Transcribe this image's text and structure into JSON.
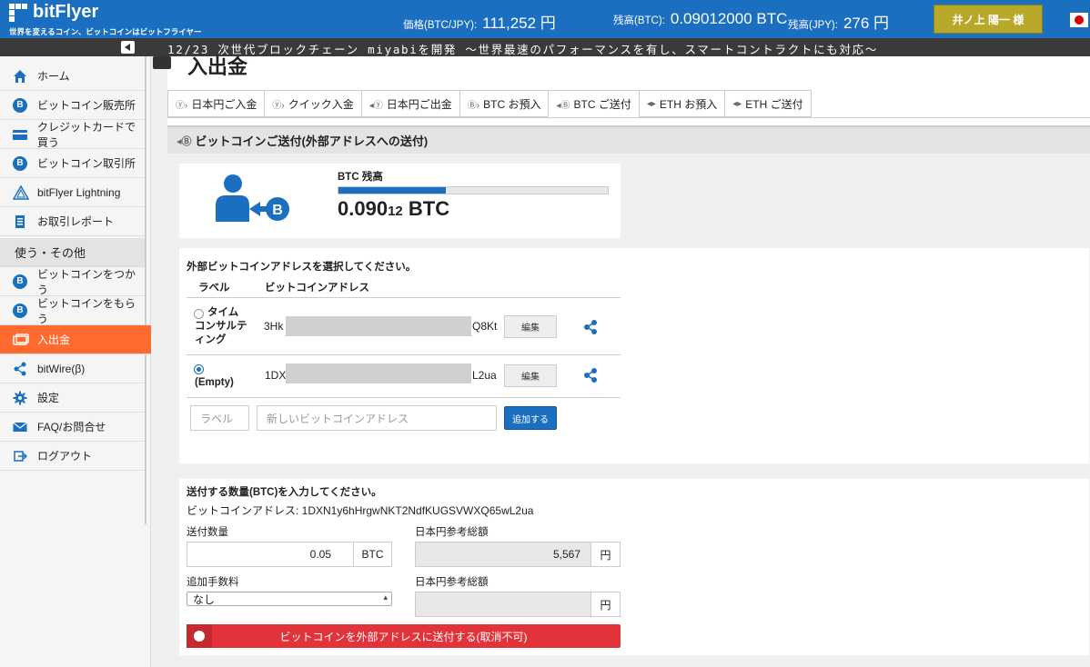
{
  "header": {
    "brand": "bitFlyer",
    "tagline": "世界を変えるコイン、ビットコインはビットフライヤー",
    "price_label": "価格(BTC/JPY):",
    "price_value": "111,252 円",
    "btc_balance_label": "残高(BTC):",
    "btc_balance_value": "0.09012000 BTC",
    "jpy_balance_label": "残高(JPY):",
    "jpy_balance_value": "276 円",
    "user_name": "井ノ上 陽一 様"
  },
  "ticker": {
    "text": "12/23 次世代ブロックチェーン miyabiを開発 〜世界最速のパフォーマンスを有し、スマートコントラクトにも対応〜"
  },
  "sidebar": {
    "items": [
      {
        "label": "ホーム",
        "icon": "home-icon"
      },
      {
        "label": "ビットコイン販売所",
        "icon": "bitcoin-icon"
      },
      {
        "label": "クレジットカードで買う",
        "icon": "credit-card-icon"
      },
      {
        "label": "ビットコイン取引所",
        "icon": "bitcoin-icon"
      },
      {
        "label": "bitFlyer Lightning",
        "icon": "lightning-icon"
      },
      {
        "label": "お取引レポート",
        "icon": "report-icon"
      }
    ],
    "section_label": "使う・その他",
    "items2": [
      {
        "label": "ビットコインをつかう",
        "icon": "bitcoin-icon"
      },
      {
        "label": "ビットコインをもらう",
        "icon": "bitcoin-icon"
      },
      {
        "label": "入出金",
        "icon": "deposit-icon"
      },
      {
        "label": "bitWire(β)",
        "icon": "share-icon"
      },
      {
        "label": "設定",
        "icon": "gear-icon"
      },
      {
        "label": "FAQ/お問合せ",
        "icon": "mail-icon"
      },
      {
        "label": "ログアウト",
        "icon": "logout-icon"
      }
    ]
  },
  "page": {
    "title": "入出金"
  },
  "tabs": [
    {
      "label": "日本円ご入金",
      "icon": "yen-in-icon"
    },
    {
      "label": "クイック入金",
      "icon": "yen-quick-icon"
    },
    {
      "label": "日本円ご出金",
      "icon": "yen-out-icon"
    },
    {
      "label": "BTC お預入",
      "icon": "btc-in-icon"
    },
    {
      "label": "BTC ご送付",
      "icon": "btc-send-icon"
    },
    {
      "label": "ETH お預入",
      "icon": "eth-in-icon"
    },
    {
      "label": "ETH ご送付",
      "icon": "eth-send-icon"
    }
  ],
  "panel": {
    "title": "ビットコインご送付(外部アドレスへの送付)"
  },
  "balance": {
    "label": "BTC 残高",
    "value_main": "0.090",
    "value_small": "12",
    "value_unit": " BTC",
    "fill_fraction": 0.4
  },
  "address_section": {
    "title": "外部ビットコインアドレスを選択してください。",
    "col_label": "ラベル",
    "col_address": "ビットコインアドレス",
    "rows": [
      {
        "label_line1": "タイム",
        "label_line2": "コンサルテ",
        "label_line3": "ィング",
        "addr_prefix": "3Hk",
        "addr_suffix": "Q8Kt",
        "edit": "編集",
        "selected": false
      },
      {
        "label_line1": "(Empty)",
        "addr_prefix": "1DX",
        "addr_suffix": "L2ua",
        "edit": "編集",
        "selected": true
      }
    ],
    "new_label_placeholder": "ラベル",
    "new_address_placeholder": "新しいビットコインアドレス",
    "add_button": "追加する"
  },
  "send_section": {
    "title": "送付する数量(BTC)を入力してください。",
    "address_line": "ビットコインアドレス: 1DXN1y6hHrgwNKT2NdfKUGSVWXQ65wL2ua",
    "amount_label": "送付数量",
    "amount_value": "0.05",
    "amount_unit": "BTC",
    "jpy_ref_label": "日本円参考総額",
    "jpy_ref_value": "5,567",
    "jpy_unit": "円",
    "fee_label": "追加手数料",
    "fee_value": "なし",
    "fee_jpy_label": "日本円参考総額",
    "fee_jpy_value": "",
    "fee_jpy_unit": "円",
    "send_button": "ビットコインを外部アドレスに送付する(取消不可)"
  }
}
